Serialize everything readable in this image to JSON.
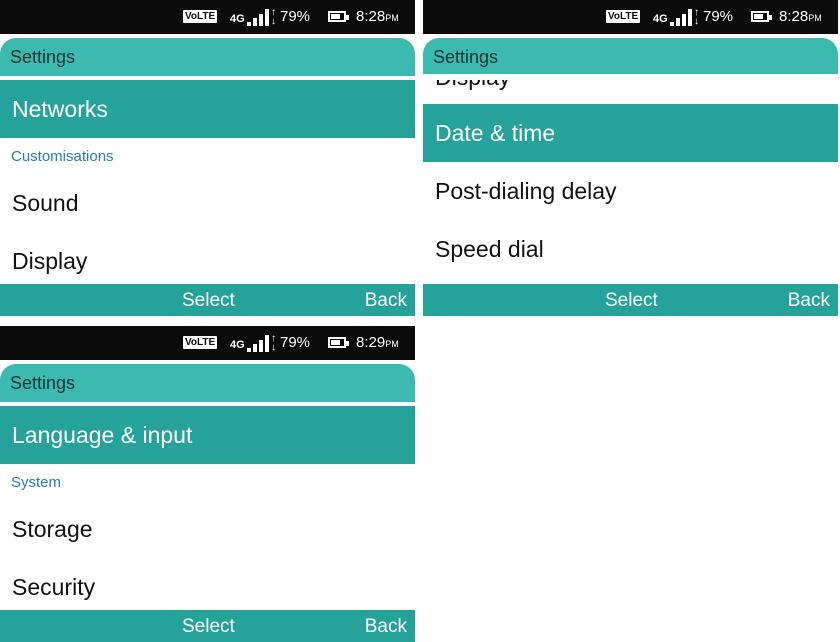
{
  "screens": [
    {
      "status": {
        "volte": "VoLTE",
        "network": "4G",
        "battery_text": "79%",
        "battery_level": 0.79,
        "time": "8:28",
        "ampm": "PM"
      },
      "title": "Settings",
      "rows": [
        {
          "kind": "item",
          "label": "Networks",
          "selected": true
        },
        {
          "kind": "category",
          "label": "Customisations"
        },
        {
          "kind": "item",
          "label": "Sound",
          "selected": false
        },
        {
          "kind": "item",
          "label": "Display",
          "selected": false
        }
      ],
      "softkeys": {
        "center": "Select",
        "right": "Back"
      }
    },
    {
      "status": {
        "volte": "VoLTE",
        "network": "4G",
        "battery_text": "79%",
        "battery_level": 0.79,
        "time": "8:28",
        "ampm": "PM"
      },
      "title": "Settings",
      "rows": [
        {
          "kind": "item",
          "label": "Display",
          "selected": false,
          "partial": true
        },
        {
          "kind": "item",
          "label": "Date & time",
          "selected": true
        },
        {
          "kind": "item",
          "label": "Post-dialing delay",
          "selected": false
        },
        {
          "kind": "item",
          "label": "Speed dial",
          "selected": false
        }
      ],
      "softkeys": {
        "center": "Select",
        "right": "Back"
      }
    },
    {
      "status": {
        "volte": "VoLTE",
        "network": "4G",
        "battery_text": "79%",
        "battery_level": 0.79,
        "time": "8:29",
        "ampm": "PM"
      },
      "title": "Settings",
      "rows": [
        {
          "kind": "item",
          "label": "Language & input",
          "selected": true
        },
        {
          "kind": "category",
          "label": "System"
        },
        {
          "kind": "item",
          "label": "Storage",
          "selected": false
        },
        {
          "kind": "item",
          "label": "Security",
          "selected": false
        }
      ],
      "softkeys": {
        "center": "Select",
        "right": "Back"
      }
    }
  ]
}
